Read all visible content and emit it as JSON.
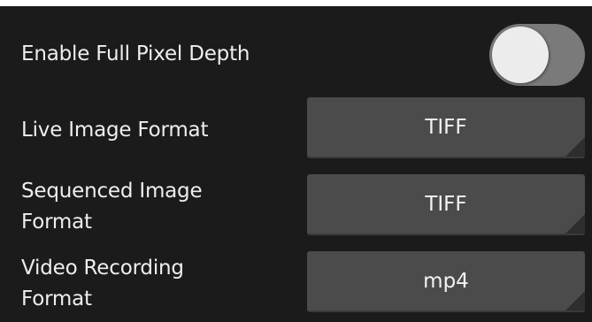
{
  "settings": {
    "full_pixel_depth": {
      "label": "Enable Full Pixel Depth",
      "enabled": false
    },
    "live_image_format": {
      "label": "Live Image Format",
      "value": "TIFF"
    },
    "sequenced_image_format": {
      "label_line1": "Sequenced Image",
      "label_line2": "Format",
      "value": "TIFF"
    },
    "video_recording_format": {
      "label_line1": "Video Recording",
      "label_line2": "Format",
      "value": "mp4"
    }
  },
  "icons": {
    "dropdown_corner": "dropdown-corner-icon"
  },
  "colors": {
    "panel_background": "#1b1b1b",
    "dropdown_background": "#4b4b4b",
    "toggle_track_off": "#7a7a7a",
    "toggle_knob": "#ececec",
    "text": "#eeeeee"
  }
}
